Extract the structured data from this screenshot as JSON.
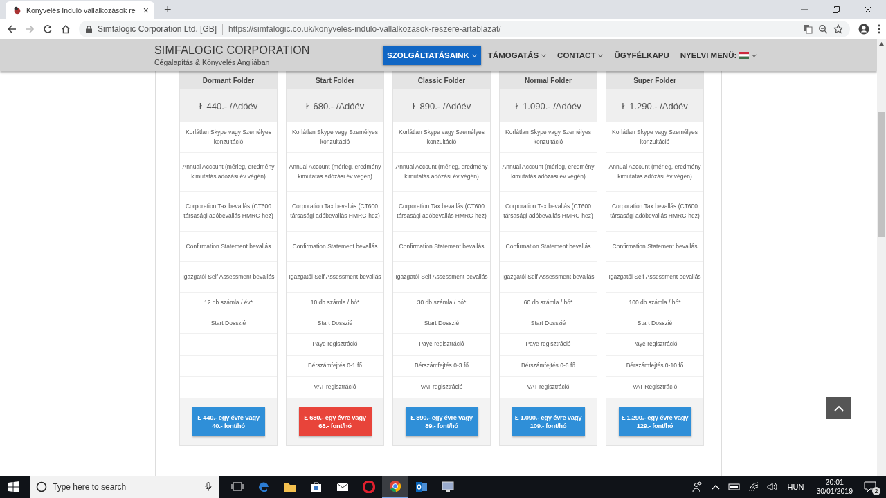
{
  "browser": {
    "tab": {
      "title": "Könyvelés Induló vállalkozások re",
      "close": "×"
    },
    "new_tab": "+",
    "site_info": "Simfalogic Corporation Ltd. [GB]",
    "url": "https://simfalogic.co.uk/konyveles-indulo-vallalkozasok-reszere-artablazat/"
  },
  "site": {
    "brand": "SIMFALOGIC CORPORATION",
    "tagline": "Cégalapítás & Könyvelés Angliában",
    "menu": [
      {
        "label": "SZOLGÁLTATÁSAINK",
        "selected": true,
        "dropdown": true
      },
      {
        "label": "TÁMOGATÁS",
        "selected": false,
        "dropdown": true
      },
      {
        "label": "CONTACT",
        "selected": false,
        "dropdown": true
      },
      {
        "label": "ÜGYFÉLKAPU",
        "selected": false,
        "dropdown": false
      },
      {
        "label": "NYELVI MENÜ:",
        "selected": false,
        "dropdown": true,
        "flag": true
      }
    ]
  },
  "plans": [
    {
      "name": "Dormant Folder",
      "price": "Ł 440.- /Adóév",
      "features": [
        "Korlátlan Skype vagy Személyes konzultáció",
        "Annual Account (mérleg, eredmény kimutatás adózási év végén)",
        "Corporation Tax bevallás (CT600 társasági adóbevallás HMRC-hez)",
        "Confirmation Statement bevallás",
        "Igazgatói Self Assessment bevallás",
        "12 db számla / év*",
        "Start Dosszié"
      ],
      "button": "Ł 440.- egy évre vagy 40.- font/hó",
      "color": "#2f8fd8"
    },
    {
      "name": "Start Folder",
      "price": "Ł 680.- /Adóév",
      "features": [
        "Korlátlan Skype vagy Személyes konzultáció",
        "Annual Account (mérleg, eredmény kimutatás adózási év végén)",
        "Corporation Tax bevallás (CT600 társasági adóbevallás HMRC-hez)",
        "Confirmation Statement bevallás",
        "Igazgatói Self Assessment bevallás",
        "10 db számla / hó*",
        "Start Dosszié",
        "Paye regisztráció",
        "Bérszámfejtés 0-1 fő",
        "VAT regisztráció"
      ],
      "button": "Ł 680.- egy évre vagy 68.- font/hó",
      "color": "#e8443a"
    },
    {
      "name": "Classic Folder",
      "price": "Ł 890.- /Adóév",
      "features": [
        "Korlátlan Skype vagy Személyes konzultáció",
        "Annual Account (mérleg, eredmény kimutatás adózási év végén)",
        "Corporation Tax bevallás (CT600 társasági adóbevallás HMRC-hez)",
        "Confirmation Statement bevallás",
        "Igazgatói Self Assessment bevallás",
        "30 db számla / hó*",
        "Start Dosszié",
        "Paye regisztráció",
        "Bérszámfejtés 0-3 fő",
        "VAT regisztráció"
      ],
      "button": "Ł 890.- egy évre vagy 89.- font/hó",
      "color": "#2f8fd8"
    },
    {
      "name": "Normal Folder",
      "price": "Ł 1.090.- /Adóév",
      "features": [
        "Korlátlan Skype vagy Személyes konzultáció",
        "Annual Account (mérleg, eredmény kimutatás adózási év végén)",
        "Corporation Tax bevallás (CT600 társasági adóbevallás HMRC-hez)",
        "Confirmation Statement bevallás",
        "Igazgatói Self Assessment bevallás",
        "60 db számla / hó*",
        "Start Dosszié",
        "Paye regisztráció",
        "Bérszámfejtés 0-6 fő",
        "VAT regisztráció"
      ],
      "button": "Ł 1.090.- egy évre vagy 109.- font/hó",
      "color": "#2f8fd8"
    },
    {
      "name": "Super Folder",
      "price": "Ł 1.290.- /Adóév",
      "features": [
        "Korlátlan Skype vagy Személyes konzultáció",
        "Annual Account (mérleg, eredmény kimutatás adózási év végén)",
        "Corporation Tax bevallás (CT600 társasági adóbevallás HMRC-hez)",
        "Confirmation Statement bevallás",
        "Igazgatói Self Assessment bevallás",
        "100 db számla / hó*",
        "Start Dosszié",
        "Paye regisztráció",
        "Bérszámfejtés 0-10 fő",
        "VAT Regisztráció"
      ],
      "button": "Ł 1.290.- egy évre vagy 129.- font/hó",
      "color": "#2f8fd8"
    }
  ],
  "taskbar": {
    "search_placeholder": "Type here to search",
    "language": "HUN",
    "time": "20:01",
    "date": "30/01/2019",
    "notifications": "2"
  }
}
